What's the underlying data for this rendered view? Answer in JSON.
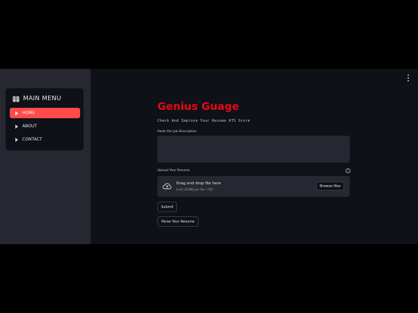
{
  "sidebar": {
    "menu_title": "MAIN MENU",
    "menu_icon": "book-icon",
    "items": [
      {
        "label": "HOME",
        "active": true
      },
      {
        "label": "ABOUT",
        "active": false
      },
      {
        "label": "CONTACT",
        "active": false
      }
    ]
  },
  "header": {
    "menu_icon": "kebab-menu-icon"
  },
  "main": {
    "title": "Genius Guage",
    "subtitle": "Check And Improve Your Resume ATS Score",
    "job_description": {
      "label": "Paste the Job Description",
      "value": "",
      "placeholder": ""
    },
    "upload": {
      "label": "Upload Your Resume",
      "help_icon": "help-circle-icon",
      "drop_text": "Drag and drop file here",
      "limit_text": "Limit 200MB per file • PDF",
      "browse_label": "Browse files",
      "icon": "cloud-upload-icon"
    },
    "submit_label": "Submit",
    "parse_label": "Parse Your Resume"
  },
  "colors": {
    "accent": "#ff4b4b",
    "title": "#e50914",
    "background": "#0e1117",
    "sidebar": "#262730"
  }
}
